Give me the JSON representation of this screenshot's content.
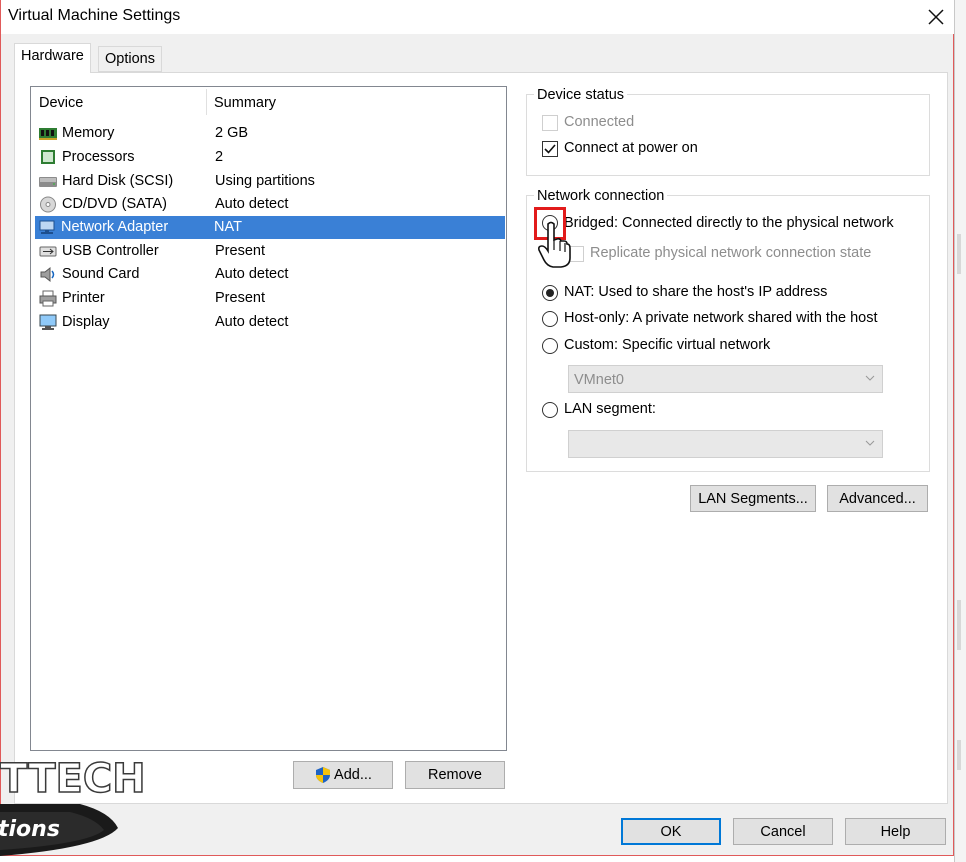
{
  "window": {
    "title": "Virtual Machine Settings"
  },
  "tabs": [
    {
      "label": "Hardware"
    },
    {
      "label": "Options"
    }
  ],
  "device_list": {
    "columns": {
      "device": "Device",
      "summary": "Summary"
    },
    "rows": [
      {
        "name": "Memory",
        "summary": "2 GB",
        "icon": "memory-icon"
      },
      {
        "name": "Processors",
        "summary": "2",
        "icon": "processor-icon"
      },
      {
        "name": "Hard Disk (SCSI)",
        "summary": "Using partitions",
        "icon": "hard-disk-icon"
      },
      {
        "name": "CD/DVD (SATA)",
        "summary": "Auto detect",
        "icon": "cd-dvd-icon"
      },
      {
        "name": "Network Adapter",
        "summary": "NAT",
        "icon": "network-adapter-icon",
        "selected": true
      },
      {
        "name": "USB Controller",
        "summary": "Present",
        "icon": "usb-icon"
      },
      {
        "name": "Sound Card",
        "summary": "Auto detect",
        "icon": "speaker-icon"
      },
      {
        "name": "Printer",
        "summary": "Present",
        "icon": "printer-icon"
      },
      {
        "name": "Display",
        "summary": "Auto detect",
        "icon": "monitor-icon"
      }
    ],
    "add_label": "Add...",
    "remove_label": "Remove"
  },
  "device_status": {
    "title": "Device status",
    "connected_label": "Connected",
    "connected_checked": false,
    "power_on_label": "Connect at power on",
    "power_on_checked": true
  },
  "network_connection": {
    "title": "Network connection",
    "bridged_label": "Bridged: Connected directly to the physical network",
    "replicate_label": "Replicate physical network connection state",
    "nat_label": "NAT: Used to share the host's IP address",
    "host_only_label": "Host-only: A private network shared with the host",
    "custom_label": "Custom: Specific virtual network",
    "custom_value": "VMnet0",
    "lan_segment_label": "LAN segment:",
    "lan_segment_value": "",
    "selected": "NAT"
  },
  "buttons": {
    "lan_segments": "LAN Segments...",
    "advanced": "Advanced...",
    "ok": "OK",
    "cancel": "Cancel",
    "help": "Help"
  },
  "watermark": {
    "line1": "TTECH",
    "line2": "tions"
  },
  "colors": {
    "selection": "#3a80d6",
    "highlight": "#e21b1b",
    "default_button_border": "#0078d7"
  }
}
